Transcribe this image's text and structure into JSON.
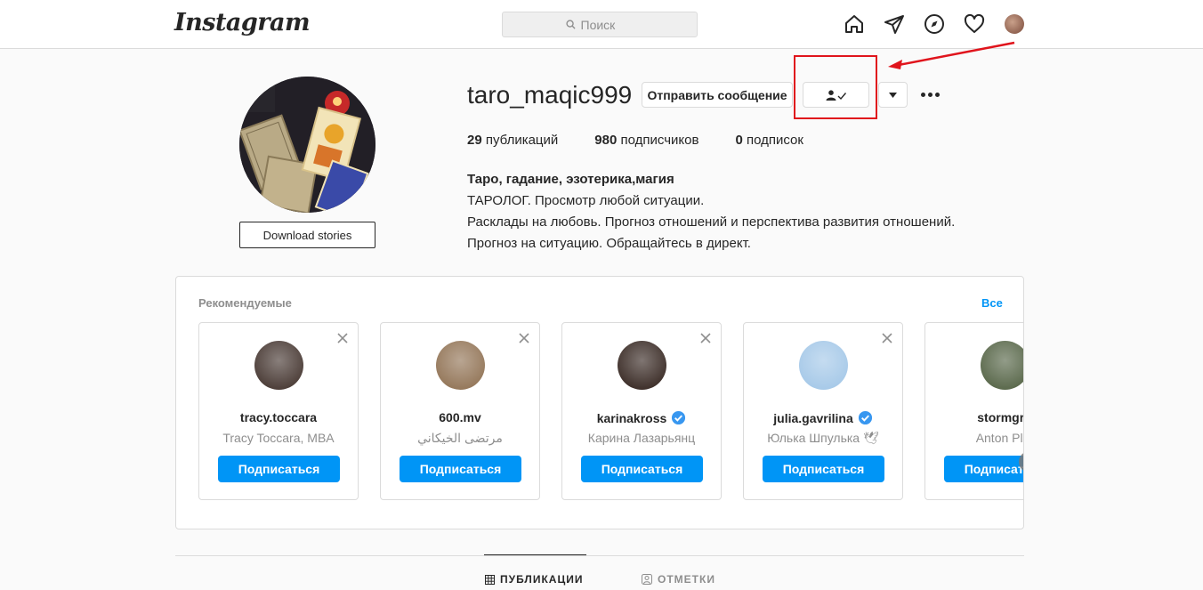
{
  "nav": {
    "logo": "Instagram",
    "search_placeholder": "Поиск"
  },
  "profile": {
    "username": "taro_maqic999",
    "message_button": "Отправить сообщение",
    "download_button": "Download stories",
    "stats": {
      "posts_count": "29",
      "posts_label": "публикаций",
      "followers_count": "980",
      "followers_label": "подписчиков",
      "following_count": "0",
      "following_label": "подписок"
    },
    "bio": {
      "name": "Таро, гадание, эзотерика,магия",
      "line1": "ТАРОЛОГ. Просмотр любой ситуации.",
      "line2": "Расклады на любовь. Прогноз отношений и перспектива развития отношений.",
      "line3": "Прогноз на ситуацию. Обращайтесь в директ."
    }
  },
  "suggestions": {
    "title": "Рекомендуемые",
    "see_all": "Все",
    "cards": [
      {
        "username": "tracy.toccara",
        "fullname": "Tracy Toccara, MBA",
        "verified": false,
        "button": "Подписаться",
        "avatar_color": "#3a2a24"
      },
      {
        "username": "600.mv",
        "fullname": "مرتضى الخيكاني",
        "verified": false,
        "button": "Подписаться",
        "avatar_color": "#8a6a4a"
      },
      {
        "username": "karinakross",
        "fullname": "Карина Лазарьянц",
        "verified": true,
        "button": "Подписаться",
        "avatar_color": "#2a1a14"
      },
      {
        "username": "julia.gavrilina",
        "fullname": "Юлька Шпулька 🕊",
        "verified": true,
        "button": "Подписаться",
        "avatar_color": "#9ec4e6"
      },
      {
        "username": "stormgro",
        "fullname": "Anton Plut",
        "verified": false,
        "button": "Подписаться",
        "avatar_color": "#4a5a3a"
      }
    ]
  },
  "tabs": {
    "posts": "ПУБЛИКАЦИИ",
    "tagged": "ОТМЕТКИ"
  },
  "colors": {
    "accent": "#0095f6",
    "highlight": "#e0141c"
  }
}
